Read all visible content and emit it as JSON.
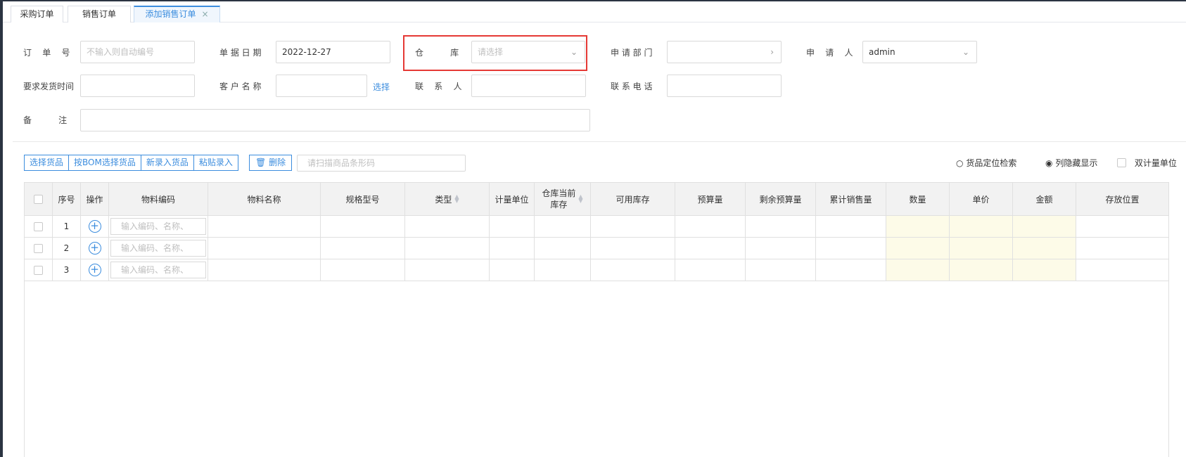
{
  "tabs": [
    {
      "label": "采购订单"
    },
    {
      "label": "销售订单"
    },
    {
      "label": "添加销售订单",
      "close": "×"
    }
  ],
  "form": {
    "order_no": {
      "label": "订    单    号",
      "placeholder": "不输入则自动编号"
    },
    "doc_date": {
      "label": "单 据 日 期",
      "value": "2022-12-27"
    },
    "warehouse": {
      "label": "仓          库",
      "placeholder": "请选择"
    },
    "department": {
      "label": "申 请 部 门",
      "value": ""
    },
    "applicant": {
      "label": "申    请    人",
      "value": "admin"
    },
    "ship_time": {
      "label": "要求发货时间",
      "value": ""
    },
    "customer": {
      "label": "客 户 名 称",
      "value": "",
      "select_link": "选择"
    },
    "contact": {
      "label": "联    系    人",
      "value": ""
    },
    "phone": {
      "label": "联 系 电 话",
      "value": ""
    },
    "remark": {
      "label": "备          注",
      "value": ""
    }
  },
  "toolbar": {
    "buttons": [
      "选择货品",
      "按BOM选择货品",
      "新录入货品",
      "粘贴录入"
    ],
    "delete_label": "删除",
    "scan_placeholder": "请扫描商品条形码",
    "locate_label": "货品定位检索",
    "columns_label": "列隐藏显示",
    "dual_unit_label": "双计量单位"
  },
  "table": {
    "headers": [
      "序号",
      "操作",
      "物料编码",
      "物料名称",
      "规格型号",
      "类型",
      "计量单位",
      "仓库当前库存",
      "可用库存",
      "预算量",
      "剩余预算量",
      "累计销售量",
      "数量",
      "单价",
      "金额",
      "存放位置"
    ],
    "header_line1": "仓库当前",
    "header_line2": "库存",
    "code_placeholder": "输入编码、名称、",
    "rows": [
      {
        "index": "1"
      },
      {
        "index": "2"
      },
      {
        "index": "3"
      }
    ]
  },
  "colors": {
    "accent": "#3c8dde",
    "highlight": "#e53935",
    "yellow_cell": "#fdfbe8"
  }
}
